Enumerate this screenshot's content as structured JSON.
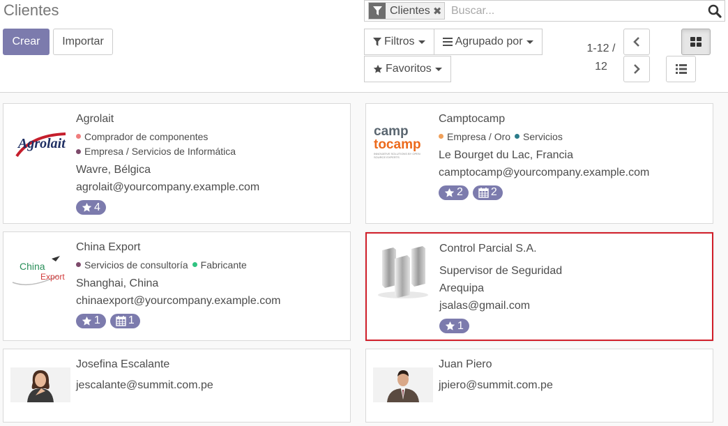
{
  "page": {
    "title": "Clientes"
  },
  "toolbar": {
    "create_label": "Crear",
    "import_label": "Importar"
  },
  "search": {
    "facet_label": "Clientes",
    "facet_remove": "✖",
    "placeholder": "Buscar..."
  },
  "filters": {
    "filters_label": "Filtros",
    "group_by_label": "Agrupado por",
    "favorites_label": "Favoritos"
  },
  "pager": {
    "value": "1-12 / 12"
  },
  "cards": [
    {
      "name": "Agrolait",
      "tags": [
        {
          "label": "Comprador de componentes",
          "color": "#f07d7d"
        },
        {
          "label": "Empresa / Servicios de Informática",
          "color": "#7d4a6b"
        }
      ],
      "lines": [
        "Wavre, Bélgica",
        "agrolait@yourcompany.example.com"
      ],
      "stars": "4",
      "meetings": null,
      "logo": {
        "kind": "agrolait",
        "text": "Agrolait"
      }
    },
    {
      "name": "Camptocamp",
      "tags": [
        {
          "label": "Empresa / Oro",
          "color": "#f0a05a"
        },
        {
          "label": "Servicios",
          "color": "#2b7c8a"
        }
      ],
      "lines": [
        "Le Bourget du Lac, Francia",
        "camptocamp@yourcompany.example.com"
      ],
      "stars": "2",
      "meetings": "2",
      "logo": {
        "kind": "camptocamp",
        "line1": "camp",
        "line2": "tocamp",
        "tagline": "INNOVATIVE SOLUTIONS BY OPEN SOURCE EXPERTS"
      }
    },
    {
      "name": "China Export",
      "tags": [
        {
          "label": "Servicios de consultoría",
          "color": "#7d4a6b"
        },
        {
          "label": "Fabricante",
          "color": "#30c381"
        }
      ],
      "lines": [
        "Shanghai, China",
        "chinaexport@yourcompany.example.com"
      ],
      "stars": "1",
      "meetings": "1",
      "logo": {
        "kind": "chinaexport",
        "line1": "China",
        "line2": "Export"
      }
    },
    {
      "name": "Control Parcial S.A.",
      "tags": [],
      "lines": [
        "Supervisor de Seguridad",
        "Arequipa",
        "jsalas@gmail.com"
      ],
      "stars": "1",
      "meetings": null,
      "logo": {
        "kind": "buildings"
      }
    },
    {
      "name": "Josefina Escalante",
      "tags": [],
      "lines": [
        "jescalante@summit.com.pe"
      ],
      "stars": null,
      "meetings": null,
      "logo": {
        "kind": "woman"
      }
    },
    {
      "name": "Juan Piero",
      "tags": [],
      "lines": [
        "jpiero@summit.com.pe"
      ],
      "stars": null,
      "meetings": null,
      "logo": {
        "kind": "man"
      }
    }
  ],
  "icons": {
    "filter": "filter-icon",
    "search": "search-icon",
    "star": "star-icon",
    "bars": "bars-icon",
    "kanban": "kanban-icon",
    "list": "list-icon",
    "calendar": "calendar-icon",
    "chevron_left": "chevron-left-icon",
    "chevron_right": "chevron-right-icon"
  },
  "colors": {
    "primary": "#7c7bad",
    "selected_border": "#d11f2a"
  }
}
